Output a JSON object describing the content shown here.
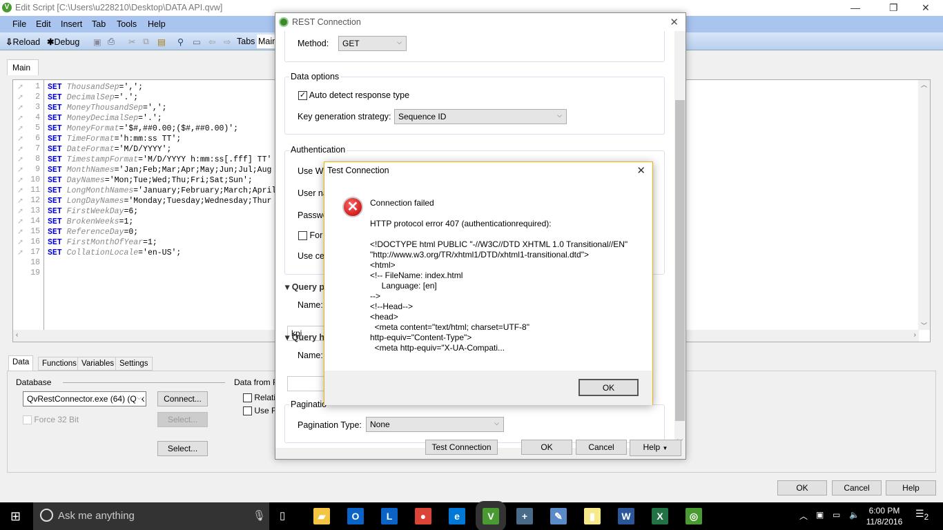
{
  "window": {
    "title": "Edit Script [C:\\Users\\u228210\\Desktop\\DATA API.qvw]"
  },
  "menu": [
    "File",
    "Edit",
    "Insert",
    "Tab",
    "Tools",
    "Help"
  ],
  "toolbar": {
    "reload": "Reload",
    "debug": "Debug",
    "tabs": "Tabs",
    "tab_select": "Main"
  },
  "editor": {
    "tab": "Main",
    "lines": [
      {
        "n": "1",
        "kw": "SET",
        "var": "ThousandSep",
        "rest": "=',';"
      },
      {
        "n": "2",
        "kw": "SET",
        "var": "DecimalSep",
        "rest": "='.';"
      },
      {
        "n": "3",
        "kw": "SET",
        "var": "MoneyThousandSep",
        "rest": "=',';"
      },
      {
        "n": "4",
        "kw": "SET",
        "var": "MoneyDecimalSep",
        "rest": "='.';"
      },
      {
        "n": "5",
        "kw": "SET",
        "var": "MoneyFormat",
        "rest": "='$#,##0.00;($#,##0.00)';"
      },
      {
        "n": "6",
        "kw": "SET",
        "var": "TimeFormat",
        "rest": "='h:mm:ss TT';"
      },
      {
        "n": "7",
        "kw": "SET",
        "var": "DateFormat",
        "rest": "='M/D/YYYY';"
      },
      {
        "n": "8",
        "kw": "SET",
        "var": "TimestampFormat",
        "rest": "='M/D/YYYY h:mm:ss[.fff] TT'"
      },
      {
        "n": "9",
        "kw": "SET",
        "var": "MonthNames",
        "rest": "='Jan;Feb;Mar;Apr;May;Jun;Jul;Aug"
      },
      {
        "n": "10",
        "kw": "SET",
        "var": "DayNames",
        "rest": "='Mon;Tue;Wed;Thu;Fri;Sat;Sun';"
      },
      {
        "n": "11",
        "kw": "SET",
        "var": "LongMonthNames",
        "rest": "='January;February;March;April"
      },
      {
        "n": "12",
        "kw": "SET",
        "var": "LongDayNames",
        "rest": "='Monday;Tuesday;Wednesday;Thur"
      },
      {
        "n": "13",
        "kw": "SET",
        "var": "FirstWeekDay",
        "rest": "=6;"
      },
      {
        "n": "14",
        "kw": "SET",
        "var": "BrokenWeeks",
        "rest": "=1;"
      },
      {
        "n": "15",
        "kw": "SET",
        "var": "ReferenceDay",
        "rest": "=0;"
      },
      {
        "n": "16",
        "kw": "SET",
        "var": "FirstMonthOfYear",
        "rest": "=1;"
      },
      {
        "n": "17",
        "kw": "SET",
        "var": "CollationLocale",
        "rest": "='en-US';"
      },
      {
        "n": "18",
        "kw": "",
        "var": "",
        "rest": ""
      },
      {
        "n": "19",
        "kw": "",
        "var": "",
        "rest": ""
      }
    ]
  },
  "bottom": {
    "tabs": [
      "Data",
      "Functions",
      "Variables",
      "Settings"
    ],
    "database_label": "Database",
    "database_value": "QvRestConnector.exe  (64) (Qlik",
    "connect": "Connect...",
    "select": "Select...",
    "force32": "Force 32 Bit",
    "data_from_files": "Data from Fil",
    "relative": "Relativ",
    "use_ftp": "Use FT",
    "select2": "Select..."
  },
  "footer": {
    "ok": "OK",
    "cancel": "Cancel",
    "help": "Help"
  },
  "rest": {
    "title": "REST Connection",
    "method_label": "Method:",
    "method_value": "GET",
    "data_options": "Data options",
    "auto_detect": "Auto detect response type",
    "auto_detect_checked": true,
    "keygen_label": "Key generation strategy:",
    "keygen_value": "Sequence ID",
    "authentication": "Authentication",
    "use_win": "Use Wi",
    "user_name": "User na",
    "password": "Passwo",
    "force": "For",
    "use_cert": "Use cer",
    "query_params": "Query p",
    "name_label": "Name:",
    "name_value": "kpi",
    "query_headers": "Query h",
    "name_label2": "Name:",
    "pagination": "Paginatio",
    "pagination_type_label": "Pagination Type:",
    "pagination_type_value": "None",
    "test_connection": "Test Connection",
    "ok": "OK",
    "cancel": "Cancel",
    "help": "Help"
  },
  "test": {
    "title": "Test Connection",
    "heading": "Connection failed",
    "message": "HTTP protocol error 407 (authenticationrequired):\n\n<!DOCTYPE html PUBLIC \"-//W3C//DTD XHTML 1.0 Transitional//EN\"\n\"http://www.w3.org/TR/xhtml1/DTD/xhtml1-transitional.dtd\">\n<html>\n<!-- FileName: index.html\n     Language: [en]\n-->\n<!--Head-->\n<head>\n  <meta content=\"text/html; charset=UTF-8\"\nhttp-equiv=\"Content-Type\">\n  <meta http-equiv=\"X-UA-Compati...",
    "ok": "OK",
    "icon": "error-icon"
  },
  "taskbar": {
    "search": "Ask me anything",
    "time": "6:00 PM",
    "date": "11/8/2016",
    "notifications": "2",
    "apps": [
      {
        "name": "file-explorer",
        "g": "▰",
        "c": "#f4c542"
      },
      {
        "name": "outlook",
        "g": "O",
        "c": "#0a64c8"
      },
      {
        "name": "lync",
        "g": "L",
        "c": "#0a64c8"
      },
      {
        "name": "chrome",
        "g": "●",
        "c": "#db4437"
      },
      {
        "name": "edge",
        "g": "e",
        "c": "#0078d7"
      },
      {
        "name": "qlikview",
        "g": "V",
        "c": "#4a9a32"
      },
      {
        "name": "sheet-tool",
        "g": "+",
        "c": "#4a6a8a"
      },
      {
        "name": "paint",
        "g": "✎",
        "c": "#5a8ac8"
      },
      {
        "name": "sticky-notes",
        "g": "▮",
        "c": "#f5e98a"
      },
      {
        "name": "word",
        "g": "W",
        "c": "#2b579a"
      },
      {
        "name": "excel",
        "g": "X",
        "c": "#217346"
      },
      {
        "name": "qlik-sense",
        "g": "◎",
        "c": "#4a9a32"
      }
    ]
  }
}
